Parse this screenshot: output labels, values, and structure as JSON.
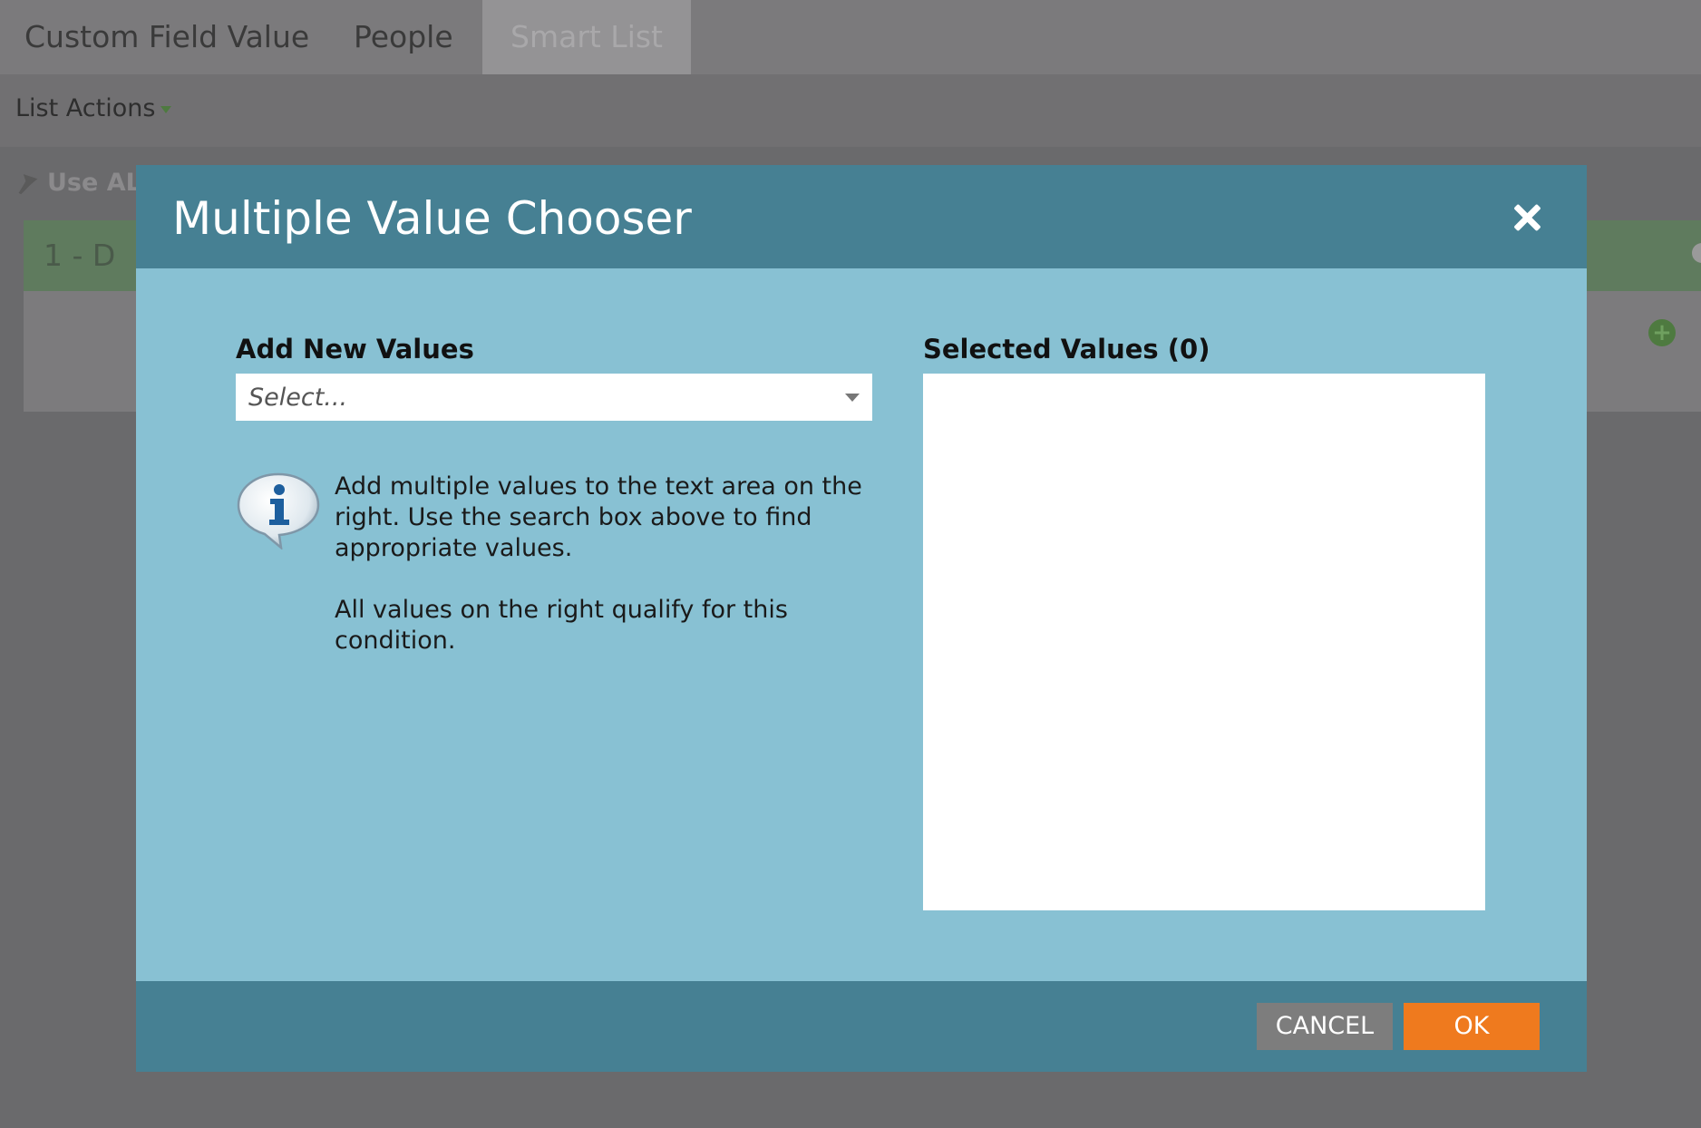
{
  "tabs": [
    {
      "label": "Custom Field Value"
    },
    {
      "label": "People"
    },
    {
      "label": "Smart List"
    }
  ],
  "toolbar": {
    "list_actions": "List Actions"
  },
  "background": {
    "use_all_label": "Use ALL",
    "filter_label": "1 - D"
  },
  "modal": {
    "title": "Multiple Value Chooser",
    "add_new_label": "Add New Values",
    "select_placeholder": "Select...",
    "info_text": "Add multiple values to the text area on the right. Use the search box above to find appropriate values.",
    "info_text_2": "All values on the right qualify for this condition.",
    "selected_label": "Selected Values (0)",
    "cancel_label": "CANCEL",
    "ok_label": "OK"
  },
  "colors": {
    "header": "#468093",
    "body": "#88c1d3",
    "ok": "#ef7a1e",
    "cancel": "#7d7d7d"
  }
}
